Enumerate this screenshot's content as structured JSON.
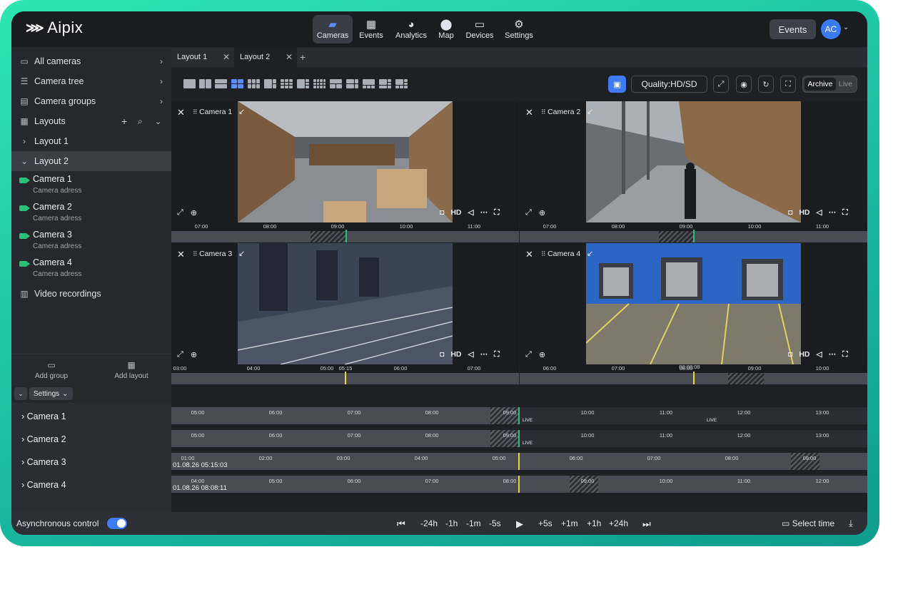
{
  "app": {
    "logo": "Aipix"
  },
  "nav": [
    {
      "label": "Cameras",
      "icon": "camera-icon",
      "glyph": "▰",
      "active": true
    },
    {
      "label": "Events",
      "icon": "calendar-icon",
      "glyph": "▦"
    },
    {
      "label": "Analytics",
      "icon": "pie-chart-icon",
      "glyph": "◕"
    },
    {
      "label": "Map",
      "icon": "map-pin-icon",
      "glyph": "⬤"
    },
    {
      "label": "Devices",
      "icon": "monitor-icon",
      "glyph": "▭"
    },
    {
      "label": "Settings",
      "icon": "gear-icon",
      "glyph": "⚙"
    }
  ],
  "header": {
    "events_button": "Events",
    "avatar": "AC"
  },
  "sidebar": {
    "sections": [
      {
        "label": "All cameras",
        "icon": "video-camera-icon"
      },
      {
        "label": "Camera tree",
        "icon": "tree-icon"
      },
      {
        "label": "Camera groups",
        "icon": "folder-icon"
      },
      {
        "label": "Layouts",
        "icon": "grid-icon"
      }
    ],
    "layouts": [
      {
        "label": "Layout 1"
      },
      {
        "label": "Layout 2"
      }
    ],
    "cameras": [
      {
        "name": "Camera 1",
        "address": "Camera adress"
      },
      {
        "name": "Camera 2",
        "address": "Camera adress"
      },
      {
        "name": "Camera 3",
        "address": "Camera adress"
      },
      {
        "name": "Camera 4",
        "address": "Camera adress"
      }
    ],
    "video_recordings": "Video recordings",
    "add_group": "Add group",
    "add_layout": "Add layout"
  },
  "settings_panel": {
    "dropdown": "Settings",
    "rows": [
      "Camera 1",
      "Camera 2",
      "Camera 3",
      "Camera 4"
    ]
  },
  "tabs": [
    {
      "label": "Layout 1"
    },
    {
      "label": "Layout 2",
      "active": true
    }
  ],
  "toolbar": {
    "quality": "Quality:HD/SD",
    "archive": "Archive",
    "live": "Live"
  },
  "cells": [
    {
      "title": "Camera 1",
      "hd": "HD",
      "ticks": [
        "07:00",
        "08:00",
        "09:00",
        "10:00",
        "11:00"
      ]
    },
    {
      "title": "Camera 2",
      "hd": "HD",
      "ticks": [
        "07:00",
        "08:00",
        "09:00",
        "10:00",
        "11:00"
      ]
    },
    {
      "title": "Camera 3",
      "hd": "HD",
      "ticks": [
        "03:00",
        "04:00",
        "05:00",
        "05:15",
        "06:00",
        "07:00"
      ]
    },
    {
      "title": "Camera 4",
      "hd": "HD",
      "ticks": [
        "06:00",
        "07:00",
        "08:00",
        "08:08:08",
        "09:00",
        "10:00"
      ]
    }
  ],
  "tracks": [
    {
      "ticks": [
        "05:00",
        "06:00",
        "07:00",
        "08:00",
        "09:00",
        "10:00",
        "11:00",
        "12:00",
        "13:00"
      ],
      "live": [
        "LIVE",
        "LIVE"
      ]
    },
    {
      "ticks": [
        "05:00",
        "06:00",
        "07:00",
        "08:00",
        "09:00",
        "10:00",
        "11:00",
        "12:00",
        "13:00"
      ],
      "live": [
        "LIVE"
      ]
    },
    {
      "ticks": [
        "01:00",
        "02:00",
        "03:00",
        "04:00",
        "05:00",
        "06:00",
        "07:00",
        "08:00",
        "09:00"
      ],
      "stamp": "01.08.26 05:15:03"
    },
    {
      "ticks": [
        "04:00",
        "05:00",
        "06:00",
        "07:00",
        "08:00",
        "09:00",
        "10:00",
        "11:00",
        "12:00"
      ],
      "stamp": "01.08.26 08:08:11"
    }
  ],
  "bottom": {
    "async_label": "Asynchronous control",
    "async_enabled": true,
    "steps": [
      "-24h",
      "-1h",
      "-1m",
      "-5s",
      "+5s",
      "+1m",
      "+1h",
      "+24h"
    ],
    "select_time": "Select time"
  },
  "colors": {
    "accent": "#3f7bf5",
    "live_marker": "#2bc07a",
    "archive_marker": "#f2d22e",
    "brand_gradient": "#1fc7a6"
  }
}
